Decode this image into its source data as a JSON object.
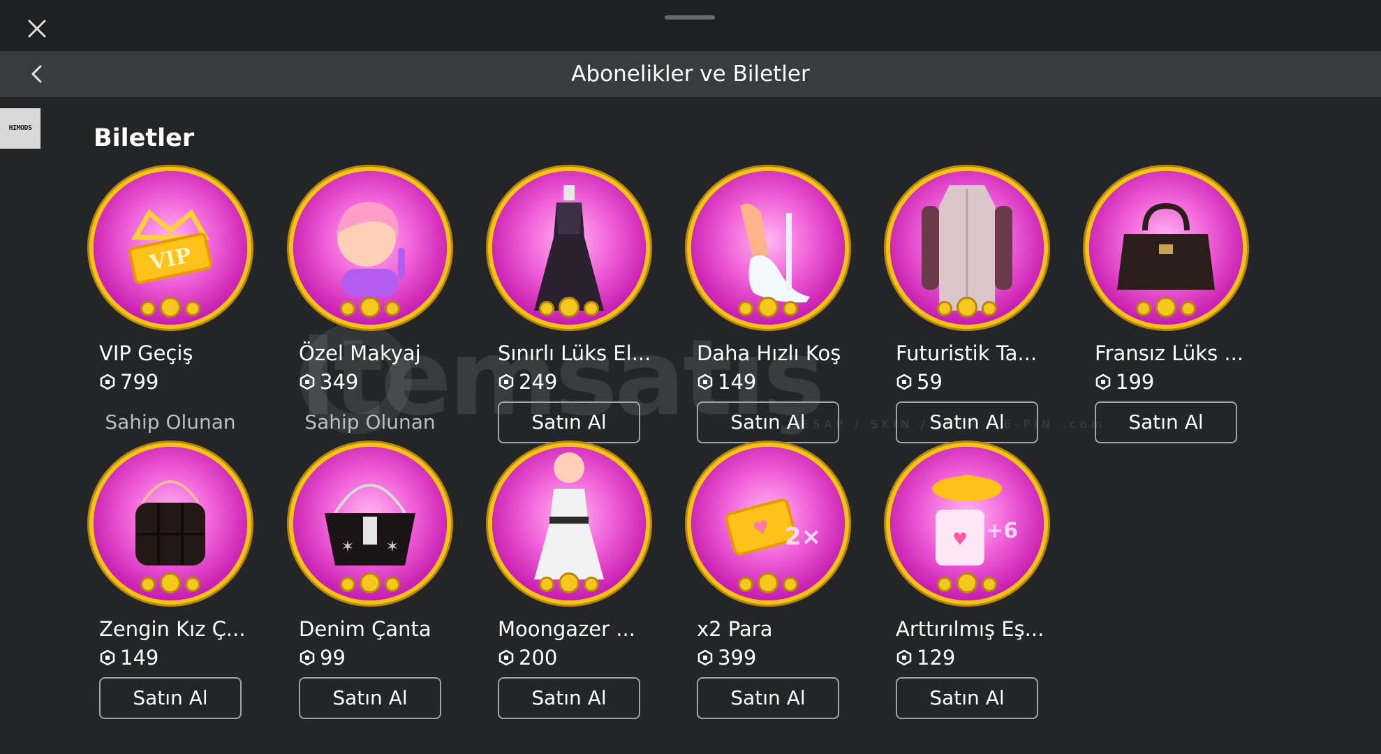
{
  "header": {
    "title": "Abonelikler ve Biletler"
  },
  "side_badge": "HIMODS",
  "section": {
    "title": "Biletler"
  },
  "items": [
    {
      "name": "VIP Geçiş",
      "price": "799",
      "status": "owned",
      "action_label": "Sahip Olunan"
    },
    {
      "name": "Özel Makyaj",
      "price": "349",
      "status": "owned",
      "action_label": "Sahip Olunan"
    },
    {
      "name": "Sınırlı Lüks El...",
      "price": "249",
      "status": "buy",
      "action_label": "Satın Al"
    },
    {
      "name": "Daha Hızlı Koş",
      "price": "149",
      "status": "buy",
      "action_label": "Satın Al"
    },
    {
      "name": "Futuristik Ta...",
      "price": "59",
      "status": "buy",
      "action_label": "Satın Al"
    },
    {
      "name": "Fransız Lüks ...",
      "price": "199",
      "status": "buy",
      "action_label": "Satın Al"
    },
    {
      "name": "Zengin Kız Ç...",
      "price": "149",
      "status": "buy",
      "action_label": "Satın Al"
    },
    {
      "name": "Denim Çanta",
      "price": "99",
      "status": "buy",
      "action_label": "Satın Al"
    },
    {
      "name": "Moongazer ...",
      "price": "200",
      "status": "buy",
      "action_label": "Satın Al"
    },
    {
      "name": "x2 Para",
      "price": "399",
      "status": "buy",
      "action_label": "Satın Al"
    },
    {
      "name": "Arttırılmış Eş...",
      "price": "129",
      "status": "buy",
      "action_label": "Satın Al"
    }
  ],
  "watermark": {
    "main": "itemsatış",
    "sub": "HESAP / SKIN / ITEM / E-PIN",
    "suffix": ".com"
  },
  "colors": {
    "background": "#232527",
    "navbar": "#393b3d",
    "topbar": "#1f2022",
    "ring_gold": "#f4c21a",
    "thumb_pink": "#f060d8"
  },
  "icons": {
    "close": "close-icon",
    "back": "chevron-left-icon",
    "currency": "robux-icon"
  }
}
